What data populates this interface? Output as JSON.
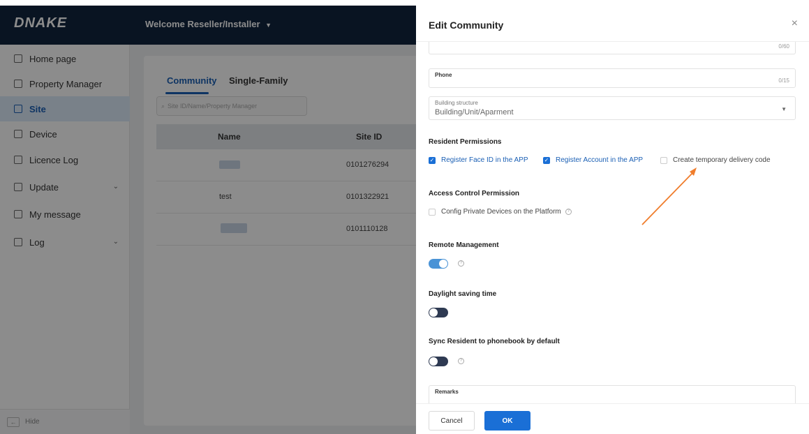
{
  "topbar": {
    "logo": "DNAKE",
    "welcome_prefix": "Welcome",
    "user": "Reseller/Installer",
    "user_caret": "▼"
  },
  "sidebar": {
    "items": [
      {
        "label": "Home page"
      },
      {
        "label": "Property Manager"
      },
      {
        "label": "Site"
      },
      {
        "label": "Device"
      },
      {
        "label": "Licence Log"
      },
      {
        "label": "Update"
      },
      {
        "label": "My message"
      },
      {
        "label": "Log"
      }
    ],
    "hide_label": "Hide",
    "hide_arrow": "←"
  },
  "main": {
    "tabs": [
      {
        "label": "Community"
      },
      {
        "label": "Single-Family"
      }
    ],
    "search_placeholder": "Site ID/Name/Property Manager",
    "columns": [
      "Name",
      "Site ID"
    ],
    "rows": [
      {
        "name": "",
        "site_id": "0101276294"
      },
      {
        "name": "test",
        "site_id": "0101322921"
      },
      {
        "name": "",
        "site_id": "0101110128"
      }
    ]
  },
  "drawer": {
    "title": "Edit Community",
    "close": "×",
    "top_field_counter": "0/60",
    "phone": {
      "label": "Phone",
      "counter": "0/15"
    },
    "building": {
      "label": "Building structure",
      "value": "Building/Unit/Aparment"
    },
    "resident_permissions": {
      "title": "Resident Permissions",
      "options": [
        {
          "label": "Register Face ID in the APP",
          "checked": true
        },
        {
          "label": "Register Account in the APP",
          "checked": true
        },
        {
          "label": "Create temporary delivery code",
          "checked": false
        }
      ]
    },
    "access_control": {
      "title": "Access Control Permission",
      "option": "Config Private Devices on the Platform"
    },
    "remote_management": {
      "title": "Remote Management",
      "enabled": true
    },
    "daylight_saving": {
      "title": "Daylight saving time",
      "enabled": false
    },
    "sync_resident": {
      "title": "Sync Resident to phonebook by default",
      "enabled": false
    },
    "remarks": {
      "label": "Remarks"
    },
    "cancel_label": "Cancel",
    "ok_label": "OK",
    "check_mark": "✓",
    "help_mark": "?"
  },
  "colors": {
    "accent": "#1a6fd6",
    "topbar": "#12263f",
    "annotation_arrow": "#f07d2c"
  }
}
